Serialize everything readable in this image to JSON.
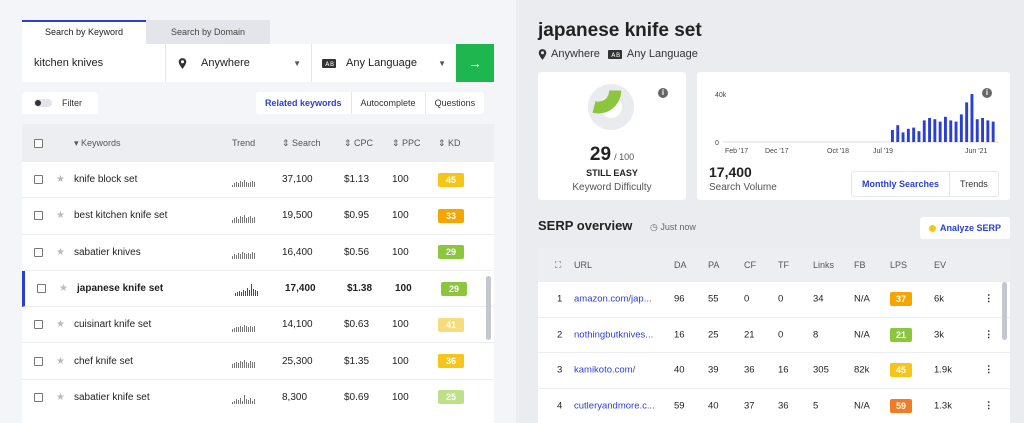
{
  "search": {
    "tabs": [
      "Search by Keyword",
      "Search by Domain"
    ],
    "keyword": "kitchen knives",
    "location": "Anywhere",
    "language": "Any Language",
    "go_icon": "arrow-right-icon"
  },
  "filter": {
    "label": "Filter"
  },
  "subtabs": [
    "Related keywords",
    "Autocomplete",
    "Questions"
  ],
  "table": {
    "headers": {
      "keywords": "Keywords",
      "trend": "Trend",
      "search": "Search",
      "cpc": "CPC",
      "ppc": "PPC",
      "kd": "KD"
    },
    "rows": [
      {
        "keyword": "knife block set",
        "search": "37,100",
        "cpc": "$1.13",
        "ppc": "100",
        "kd": "45",
        "kd_color": "#f5c518",
        "trend": [
          2,
          4,
          5,
          4,
          6,
          5,
          7,
          5,
          4,
          5,
          6,
          5
        ]
      },
      {
        "keyword": "best kitchen knife set",
        "search": "19,500",
        "cpc": "$0.95",
        "ppc": "100",
        "kd": "33",
        "kd_color": "#f5a400",
        "trend": [
          3,
          5,
          6,
          4,
          7,
          6,
          8,
          5,
          6,
          7,
          5,
          6
        ]
      },
      {
        "keyword": "sabatier knives",
        "search": "16,400",
        "cpc": "$0.56",
        "ppc": "100",
        "kd": "29",
        "kd_color": "#8cc63f",
        "trend": [
          3,
          5,
          4,
          6,
          5,
          7,
          6,
          5,
          6,
          5,
          7,
          6
        ]
      },
      {
        "keyword": "japanese knife set",
        "search": "17,400",
        "cpc": "$1.38",
        "ppc": "100",
        "kd": "29",
        "kd_color": "#8cc63f",
        "trend": [
          3,
          4,
          5,
          4,
          6,
          5,
          8,
          6,
          12,
          7,
          6,
          5
        ]
      },
      {
        "keyword": "cuisinart knife set",
        "search": "14,100",
        "cpc": "$0.63",
        "ppc": "100",
        "kd": "41",
        "kd_color": "#f4dd7c",
        "trend": [
          3,
          4,
          5,
          5,
          6,
          5,
          7,
          6,
          5,
          6,
          5,
          6
        ]
      },
      {
        "keyword": "chef knife set",
        "search": "25,300",
        "cpc": "$1.35",
        "ppc": "100",
        "kd": "36",
        "kd_color": "#f5c518",
        "trend": [
          4,
          5,
          6,
          5,
          7,
          6,
          8,
          6,
          5,
          7,
          6,
          6
        ]
      },
      {
        "keyword": "sabatier knife set",
        "search": "8,300",
        "cpc": "$0.69",
        "ppc": "100",
        "kd": "25",
        "kd_color": "#bfe08a",
        "trend": [
          2,
          3,
          5,
          4,
          6,
          3,
          9,
          5,
          4,
          6,
          3,
          5
        ]
      }
    ]
  },
  "detail": {
    "title": "japanese knife set",
    "location": "Anywhere",
    "language": "Any Language",
    "difficulty": {
      "value": "29",
      "max": "/ 100",
      "label": "STILL EASY",
      "caption": "Keyword Difficulty",
      "fraction": 0.29
    },
    "volume": {
      "value": "17,400",
      "caption": "Search Volume"
    },
    "buttons": [
      "Monthly Searches",
      "Trends"
    ]
  },
  "chart_data": {
    "type": "bar",
    "x_ticks": [
      "Feb '17",
      "Dec '17",
      "Oct '18",
      "Jul '19",
      "Jun '21"
    ],
    "y_ticks": [
      "40k",
      "0"
    ],
    "ylim": [
      0,
      40000
    ],
    "values": [
      10000,
      14000,
      8000,
      11000,
      12000,
      9000,
      18000,
      20000,
      19000,
      17000,
      21000,
      18000,
      17000,
      23000,
      33000,
      40000,
      19000,
      20000,
      18000,
      17000
    ]
  },
  "serp": {
    "title": "SERP overview",
    "updated": "Just now",
    "analyze_label": "Analyze SERP",
    "headers": {
      "url": "URL",
      "da": "DA",
      "pa": "PA",
      "cf": "CF",
      "tf": "TF",
      "links": "Links",
      "fb": "FB",
      "lps": "LPS",
      "ev": "EV"
    },
    "rows": [
      {
        "n": "1",
        "url": "amazon.com/jap...",
        "da": "96",
        "pa": "55",
        "cf": "0",
        "tf": "0",
        "links": "34",
        "fb": "N/A",
        "lps": "37",
        "lps_color": "#f5a400",
        "ev": "6k"
      },
      {
        "n": "2",
        "url": "nothingbutknives...",
        "da": "16",
        "pa": "25",
        "cf": "21",
        "tf": "0",
        "links": "8",
        "fb": "N/A",
        "lps": "21",
        "lps_color": "#8cc63f",
        "ev": "3k"
      },
      {
        "n": "3",
        "url": "kamikoto.com/",
        "da": "40",
        "pa": "39",
        "cf": "36",
        "tf": "16",
        "links": "305",
        "fb": "82k",
        "lps": "45",
        "lps_color": "#f5c518",
        "ev": "1.9k"
      },
      {
        "n": "4",
        "url": "cutleryandmore.c...",
        "da": "59",
        "pa": "40",
        "cf": "37",
        "tf": "36",
        "links": "5",
        "fb": "N/A",
        "lps": "59",
        "lps_color": "#f07c28",
        "ev": "1.3k"
      }
    ]
  }
}
